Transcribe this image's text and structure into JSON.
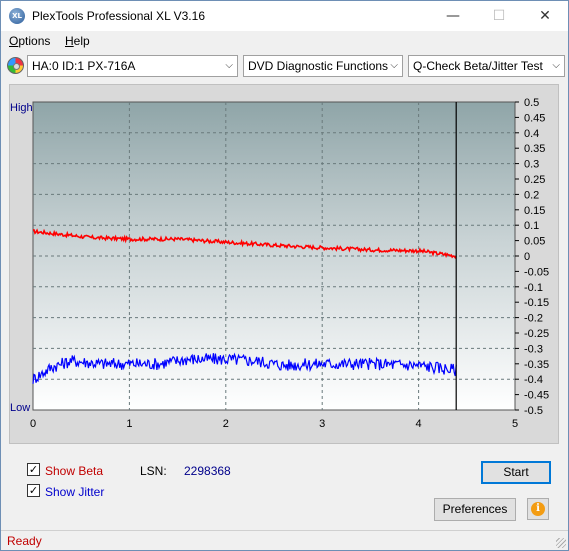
{
  "window": {
    "app_icon_text": "XL",
    "title": "PlexTools Professional XL V3.16",
    "controls": {
      "minimize": "—",
      "maximize": "☐",
      "close": "✕"
    }
  },
  "menu": [
    {
      "label": "Options",
      "accel": "O",
      "rest": "ptions"
    },
    {
      "label": "Help",
      "accel": "H",
      "rest": "elp"
    }
  ],
  "toolbar": {
    "drive_icon": "disc-icon",
    "drive": "HA:0 ID:1  PX-716A",
    "function": "DVD Diagnostic Functions",
    "test": "Q-Check Beta/Jitter Test",
    "arrow": "⌵"
  },
  "chart_labels": {
    "high": "High",
    "low": "Low"
  },
  "chart_data": {
    "type": "line",
    "x_ticks": [
      "0",
      "1",
      "2",
      "3",
      "4",
      "5"
    ],
    "xlim": [
      0,
      5
    ],
    "y_right_ticks": [
      "0.5",
      "0.45",
      "0.4",
      "0.35",
      "0.3",
      "0.25",
      "0.2",
      "0.15",
      "0.1",
      "0.05",
      "0",
      "-0.05",
      "-0.1",
      "-0.15",
      "-0.2",
      "-0.25",
      "-0.3",
      "-0.35",
      "-0.4",
      "-0.45",
      "-0.5"
    ],
    "ylim": [
      -0.5,
      0.5
    ],
    "end_marker_x": 4.39,
    "grid": true,
    "series": [
      {
        "name": "Beta",
        "color": "#ff0000",
        "x": [
          0.0,
          0.3,
          0.6,
          1.0,
          1.5,
          2.0,
          2.5,
          3.0,
          3.5,
          4.0,
          4.39
        ],
        "y": [
          0.08,
          0.07,
          0.06,
          0.055,
          0.055,
          0.045,
          0.035,
          0.027,
          0.02,
          0.017,
          0.0
        ]
      },
      {
        "name": "Jitter",
        "color": "#0000ff",
        "x": [
          0.0,
          0.2,
          0.4,
          0.7,
          1.0,
          1.3,
          1.6,
          2.0,
          2.3,
          2.6,
          3.0,
          3.5,
          4.0,
          4.39
        ],
        "y": [
          -0.4,
          -0.36,
          -0.34,
          -0.35,
          -0.35,
          -0.35,
          -0.335,
          -0.335,
          -0.34,
          -0.355,
          -0.35,
          -0.35,
          -0.355,
          -0.37
        ]
      }
    ]
  },
  "options": {
    "show_beta": {
      "label": "Show Beta",
      "checked": true,
      "color": "#c00000"
    },
    "show_jitter": {
      "label": "Show Jitter",
      "checked": true,
      "color": "#0000cc"
    },
    "check_mark": "✓"
  },
  "lsn": {
    "label": "LSN:",
    "value": "2298368"
  },
  "buttons": {
    "start": "Start",
    "preferences": "Preferences",
    "info_icon": "i"
  },
  "status": "Ready"
}
